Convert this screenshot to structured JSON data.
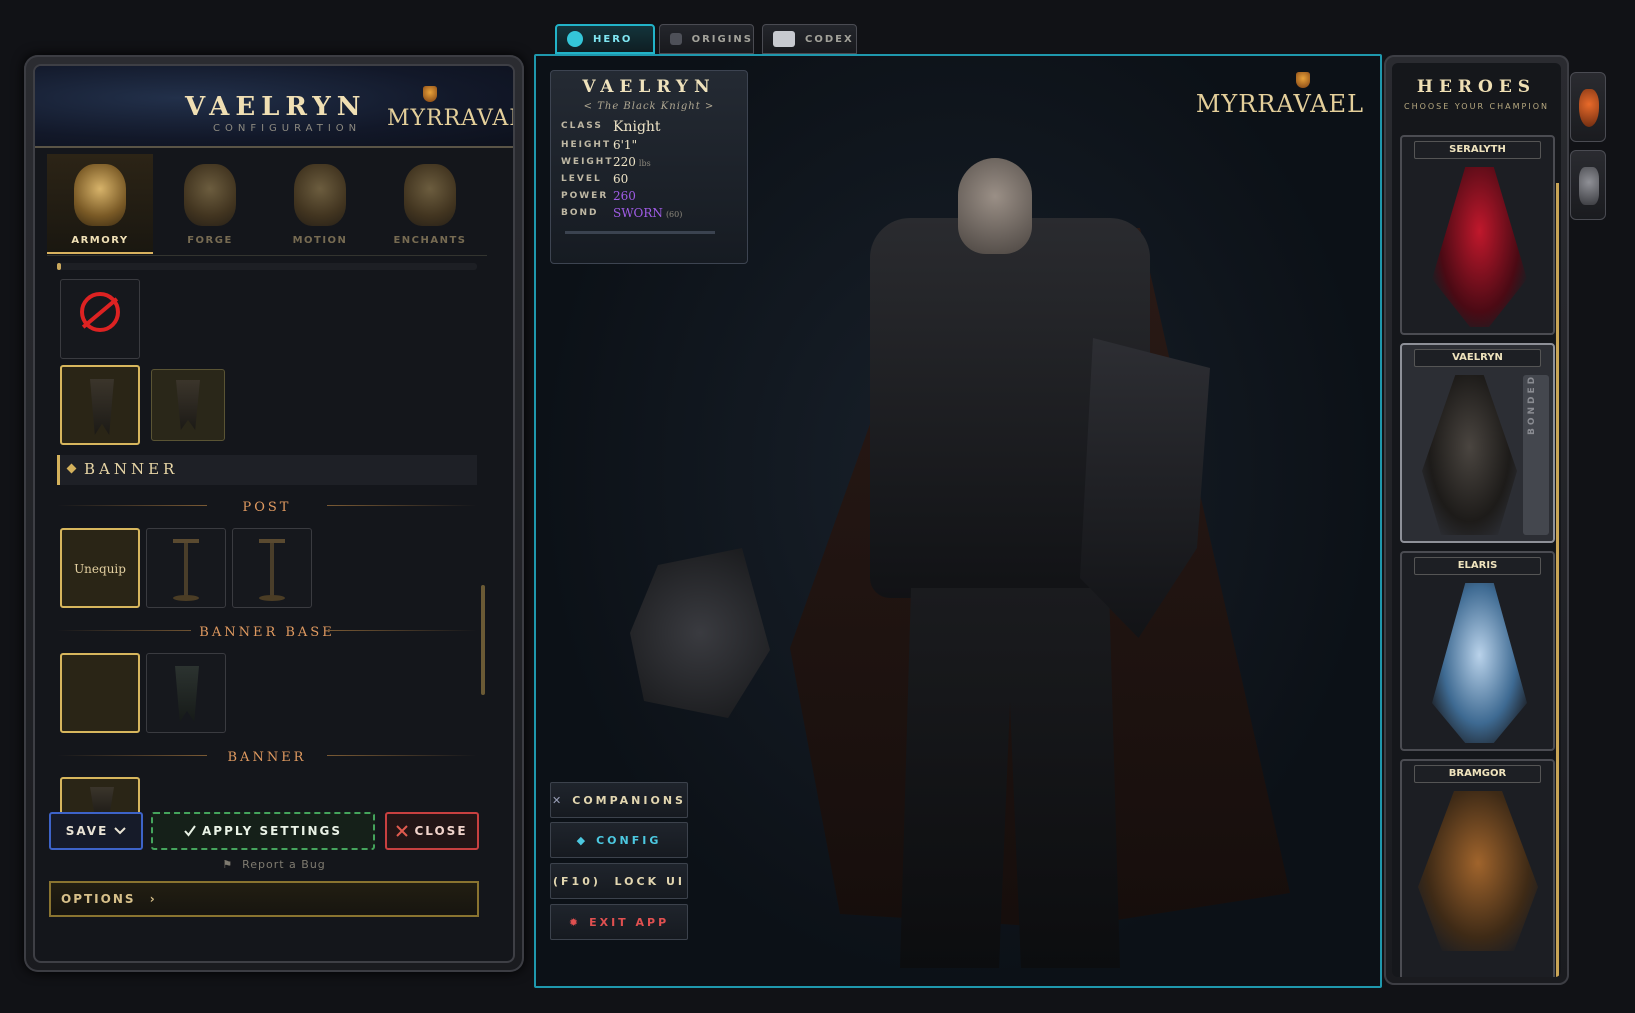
{
  "left_panel": {
    "title": "VAELRYN",
    "subtitle": "CONFIGURATION",
    "brand": "MYRRAVAEL",
    "tabs": [
      {
        "label": "ARMORY",
        "active": true
      },
      {
        "label": "FORGE",
        "active": false
      },
      {
        "label": "MOTION",
        "active": false
      },
      {
        "label": "ENCHANTS",
        "active": false
      }
    ],
    "progress": 0.01,
    "section_title": "BANNER",
    "subsections": {
      "post": "POST",
      "banner_base": "BANNER BASE",
      "banner": "BANNER"
    },
    "unequip_label": "Unequip",
    "buttons": {
      "save": "SAVE",
      "apply": "APPLY SETTINGS",
      "close": "CLOSE"
    },
    "report_link": "Report a Bug",
    "options": "OPTIONS"
  },
  "top_tabs": [
    {
      "label": "HERO",
      "active": true
    },
    {
      "label": "ORIGINS",
      "active": false
    },
    {
      "label": "CODEX",
      "active": false
    }
  ],
  "viewport": {
    "brand": "MYRRAVAEL",
    "stats": {
      "name": "VAELRYN",
      "epithet": "< The Black Knight >",
      "rows": [
        {
          "key": "CLASS",
          "value": "Knight"
        },
        {
          "key": "HEIGHT",
          "value": "6'1\""
        },
        {
          "key": "WEIGHT",
          "value": "220",
          "unit": "lbs"
        },
        {
          "key": "LEVEL",
          "value": "60"
        },
        {
          "key": "POWER",
          "value": "260"
        },
        {
          "key": "BOND",
          "value": "SWORN",
          "unit": "(60)"
        }
      ]
    },
    "buttons": {
      "companions": "COMPANIONS",
      "config": "CONFIG",
      "lock_ui": "(F10)  LOCK UI",
      "exit": "EXIT APP"
    }
  },
  "heroes": {
    "title": "HEROES",
    "subtitle": "CHOOSE YOUR CHAMPION",
    "list": [
      {
        "name": "SERALYTH",
        "selected": false
      },
      {
        "name": "VAELRYN",
        "selected": true,
        "tag": "BONDED"
      },
      {
        "name": "ELARIS",
        "selected": false
      },
      {
        "name": "BRAMGOR",
        "selected": false
      }
    ]
  },
  "colors": {
    "accent_cyan": "#1f98ad",
    "gold": "#d7b65d",
    "save_blue": "#3d63c8",
    "apply_green": "#45a45c",
    "close_red": "#c84040",
    "power_purple": "#a05ce6"
  },
  "icons": {
    "hero_tab": "compass-icon",
    "origins_tab": "star-icon",
    "codex_tab": "book-icon",
    "companions": "sword-icon",
    "config": "diamond-icon",
    "exit": "gear-icon",
    "report": "flag-icon",
    "options": "chevron-right-icon"
  }
}
